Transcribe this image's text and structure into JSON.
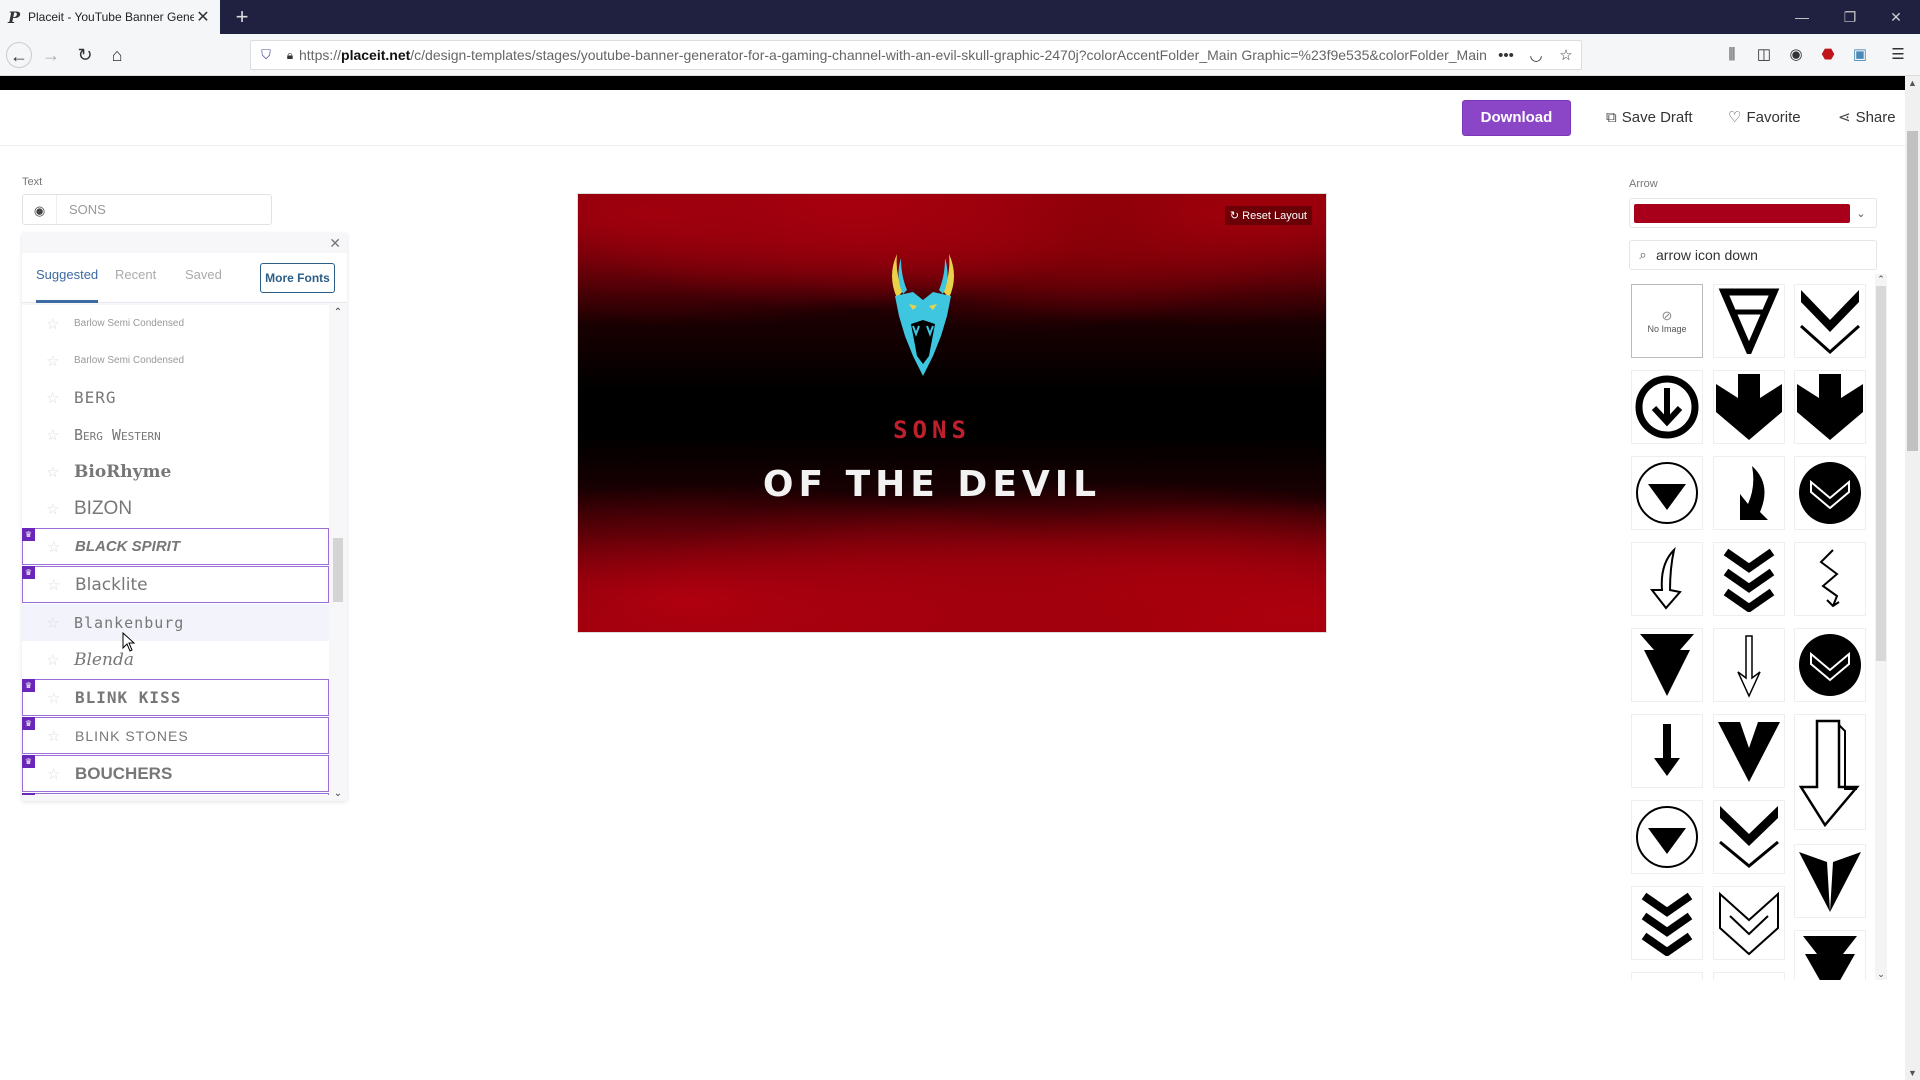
{
  "browser": {
    "tab_title": "Placeit - YouTube Banner Generator",
    "tab_favicon": "P",
    "url_prefix": "https://",
    "url_domain": "placeit.net",
    "url_path": "/c/design-templates/stages/youtube-banner-generator-for-a-gaming-channel-with-an-evil-skull-graphic-2470j?colorAccentFolder_Main Graphic=%23f9e535&colorFolder_Main Graphic=",
    "window_controls": [
      "minimize",
      "restore",
      "close"
    ]
  },
  "header": {
    "download_label": "Download",
    "save_draft_label": "Save Draft",
    "favorite_label": "Favorite",
    "share_label": "Share"
  },
  "text_editor": {
    "label": "Text",
    "value": "SONS"
  },
  "font_picker": {
    "tabs": [
      {
        "label": "Suggested",
        "active": true
      },
      {
        "label": "Recent",
        "active": false
      },
      {
        "label": "Saved",
        "active": false
      }
    ],
    "more_fonts_label": "More Fonts",
    "fonts": [
      {
        "name": "Barlow Semi Condensed",
        "premium": false
      },
      {
        "name": "Barlow Semi Condensed",
        "premium": false
      },
      {
        "name": "BERG",
        "premium": false
      },
      {
        "name": "Berg Western",
        "premium": false
      },
      {
        "name": "BioRhyme",
        "premium": false
      },
      {
        "name": "BIZON",
        "premium": false
      },
      {
        "name": "BLACK SPIRIT",
        "premium": true
      },
      {
        "name": "Blacklite",
        "premium": true
      },
      {
        "name": "Blankenburg",
        "premium": false
      },
      {
        "name": "Blenda",
        "premium": false
      },
      {
        "name": "BLINK KISS",
        "premium": true
      },
      {
        "name": "BLINK STONES",
        "premium": true
      },
      {
        "name": "BOUCHERS",
        "premium": true
      },
      {
        "name": "",
        "premium": true
      }
    ]
  },
  "canvas": {
    "reset_layout_label": "Reset Layout",
    "line1": "SONS",
    "line2": "OF THE DEVIL",
    "accent_color": "#c0202e",
    "graphic": "evil-skull-graphic"
  },
  "graphic_panel": {
    "label": "Arrow",
    "selected_color": "#a8001a",
    "search_value": "arrow icon down",
    "no_image_label": "No Image",
    "icons": [
      "no-image",
      "nested-triangles-down",
      "double-chevron-down",
      "circle-arrow-down",
      "block-arrow-down",
      "block-arrow-down",
      "circle-triangle-down",
      "curved-arrow-down",
      "circle-chevron-down",
      "sketch-curved-arrow-down",
      "triple-chevron-down",
      "zigzag-arrow-down",
      "triangle-down",
      "thin-arrow-down",
      "circle-chevron-down",
      "small-arrow-down",
      "v-chevron-down",
      "sketch-block-arrow-down",
      "circle-triangle-down",
      "double-chevron-down",
      "arrowhead-down",
      "triple-chevron-down",
      "outline-chevrons-down",
      "double-triangle-down"
    ]
  }
}
